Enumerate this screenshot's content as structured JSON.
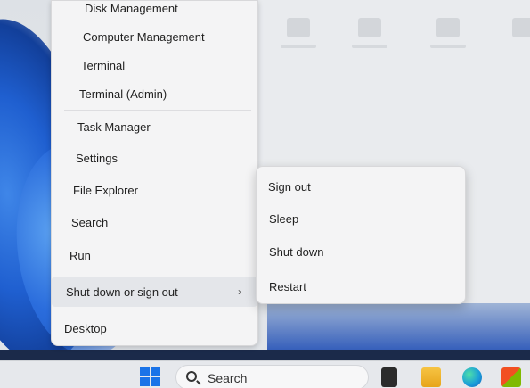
{
  "context_menu": {
    "items": [
      {
        "label": "Disk Management"
      },
      {
        "label": "Computer Management"
      },
      {
        "label": "Terminal"
      },
      {
        "label": "Terminal (Admin)"
      },
      {
        "label": "Task Manager"
      },
      {
        "label": "Settings"
      },
      {
        "label": "File Explorer"
      },
      {
        "label": "Search"
      },
      {
        "label": "Run"
      },
      {
        "label": "Shut down or sign out"
      },
      {
        "label": "Desktop"
      }
    ],
    "chevron": "›"
  },
  "submenu": {
    "items": [
      {
        "label": "Sign out"
      },
      {
        "label": "Sleep"
      },
      {
        "label": "Shut down"
      },
      {
        "label": "Restart"
      }
    ]
  },
  "taskbar": {
    "search_label": "Search",
    "icons": [
      "windows-start-icon",
      "task-view-icon",
      "file-explorer-icon",
      "edge-browser-icon",
      "microsoft-store-icon"
    ]
  },
  "colors": {
    "accent": "#1a73e8",
    "menu_bg": "#f4f4f5",
    "wallpaper_blue": "#1f5fd0"
  }
}
